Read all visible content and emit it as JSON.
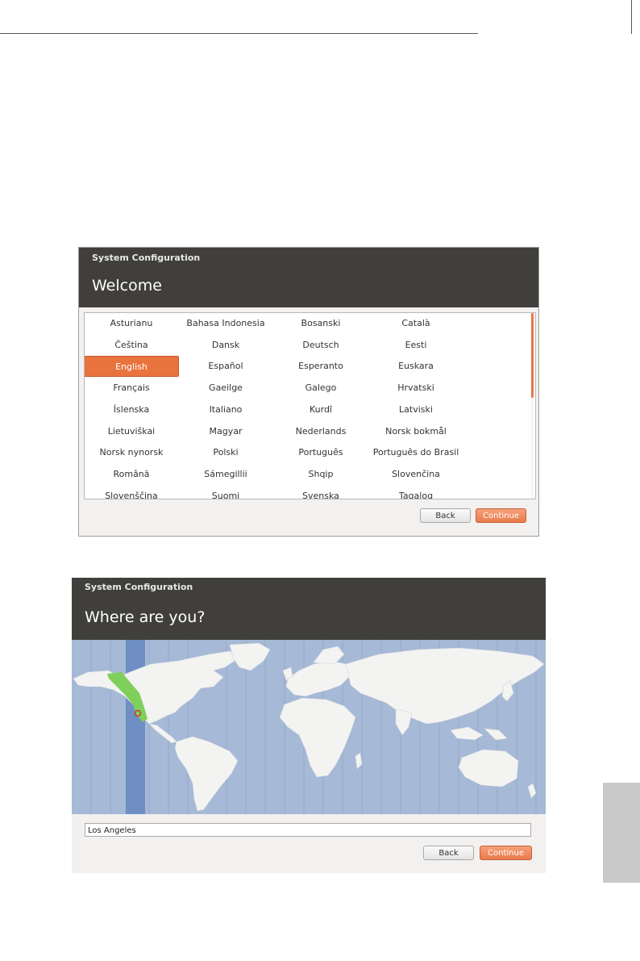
{
  "welcome_window": {
    "title": "System Configuration",
    "heading": "Welcome",
    "languages": [
      "Asturianu",
      "Bahasa Indonesia",
      "Bosanski",
      "Català",
      "Čeština",
      "Dansk",
      "Deutsch",
      "Eesti",
      "English",
      "Español",
      "Esperanto",
      "Euskara",
      "Français",
      "Gaeilge",
      "Galego",
      "Hrvatski",
      "Íslenska",
      "Italiano",
      "Kurdî",
      "Latviski",
      "Lietuviškai",
      "Magyar",
      "Nederlands",
      "Norsk bokmål",
      "Norsk nynorsk",
      "Polski",
      "Português",
      "Português do Brasil",
      "Română",
      "Sámegillii",
      "Shqip",
      "Slovenčina",
      "Slovenščina",
      "Suomi",
      "Svenska",
      "Tagalog"
    ],
    "selected_language": "English",
    "back_label": "Back",
    "continue_label": "Continue"
  },
  "where_window": {
    "title": "System Configuration",
    "heading": "Where are you?",
    "city_value": "Los Angeles",
    "back_label": "Back",
    "continue_label": "Continue"
  },
  "colors": {
    "header": "#403f3b",
    "accent": "#e9733c",
    "ocean": "#a6b9d6",
    "land": "#f3f3f1",
    "timezone_band": "#6f8fc4",
    "timezone_region": "#7ed05a"
  }
}
